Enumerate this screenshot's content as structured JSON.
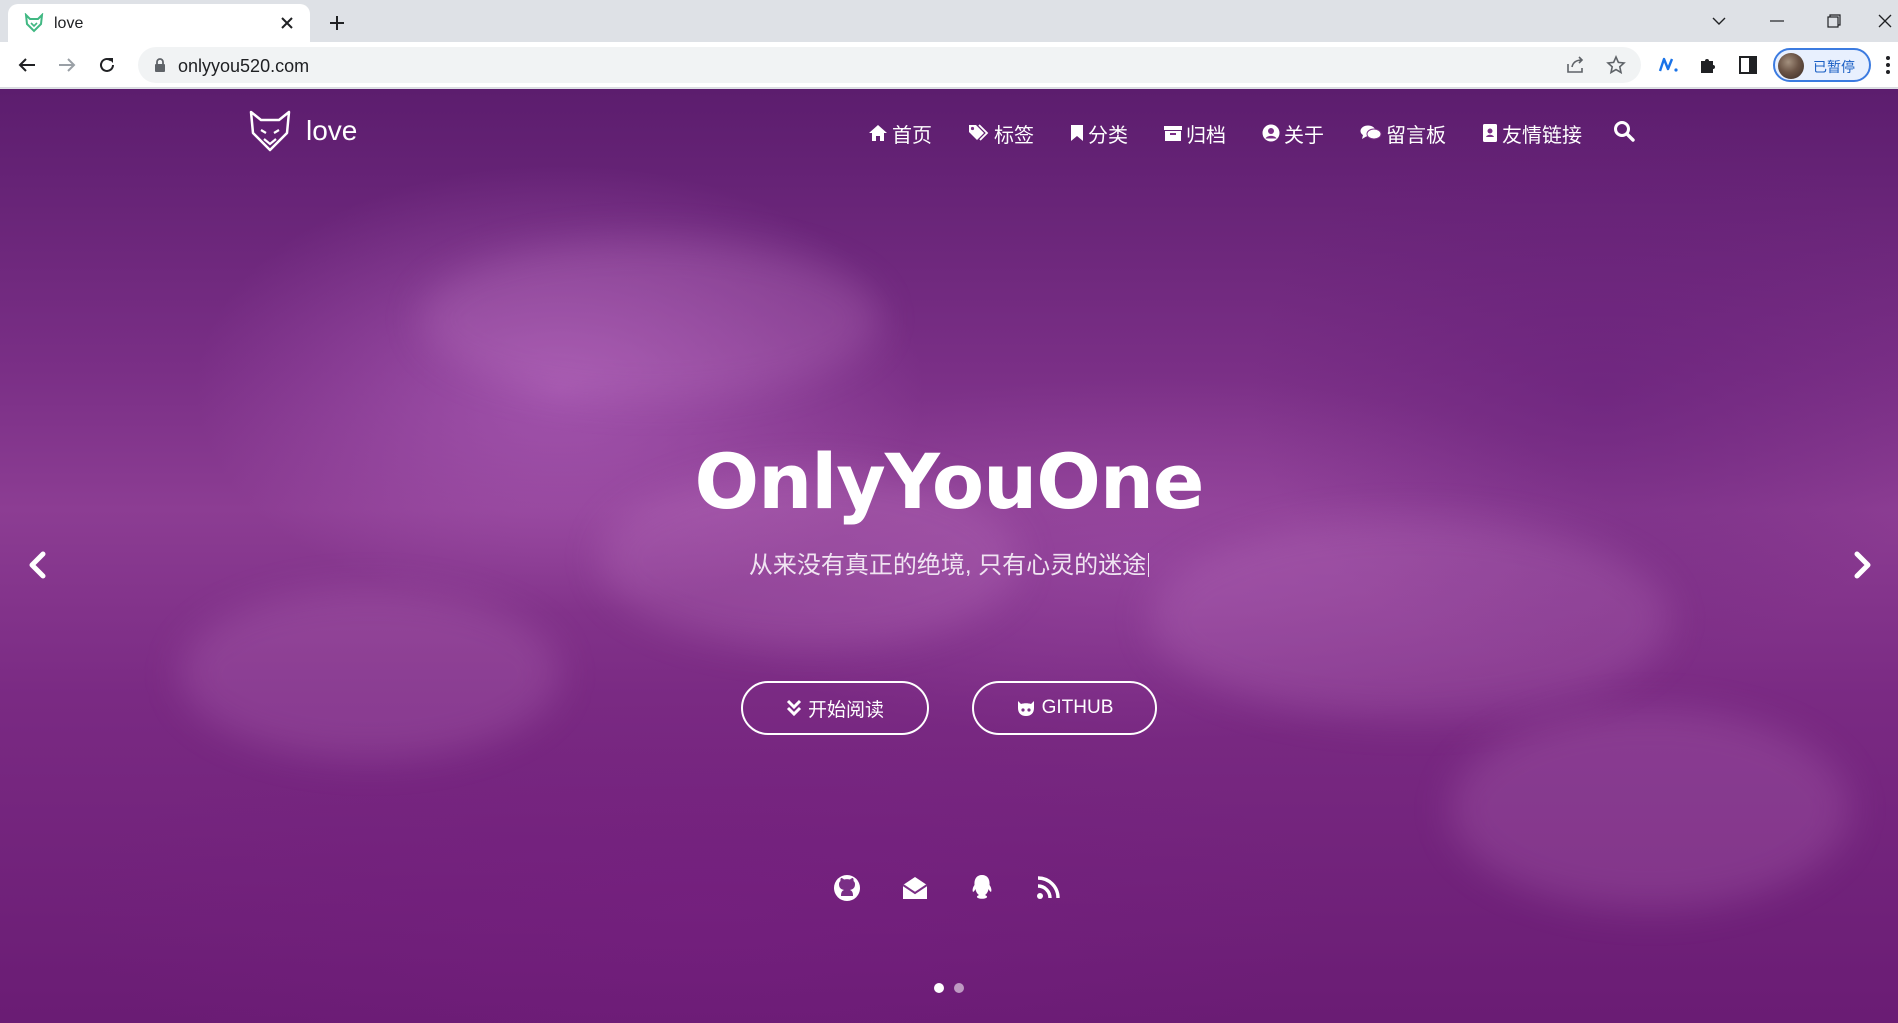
{
  "browser": {
    "tab": {
      "title": "love"
    },
    "address": {
      "url": "onlyyou520.com"
    },
    "profile": {
      "status": "已暂停"
    }
  },
  "site": {
    "logo_text": "love",
    "nav": [
      {
        "label": "首页",
        "icon": "home-icon"
      },
      {
        "label": "标签",
        "icon": "tags-icon"
      },
      {
        "label": "分类",
        "icon": "bookmark-icon"
      },
      {
        "label": "归档",
        "icon": "archive-icon"
      },
      {
        "label": "关于",
        "icon": "user-circle-icon"
      },
      {
        "label": "留言板",
        "icon": "comments-icon"
      },
      {
        "label": "友情链接",
        "icon": "address-book-icon"
      }
    ],
    "hero": {
      "title": "OnlyYouOne",
      "subtitle": "从来没有真正的绝境, 只有心灵的迷途",
      "read_button": "开始阅读",
      "github_button": "GITHUB"
    },
    "social": [
      "github-icon",
      "envelope-icon",
      "qq-icon",
      "rss-icon"
    ],
    "carousel": {
      "slides": 2,
      "active": 1
    }
  },
  "colors": {
    "accent": "#7a2f86",
    "text": "#ffffff",
    "favicon": "#41b883"
  }
}
